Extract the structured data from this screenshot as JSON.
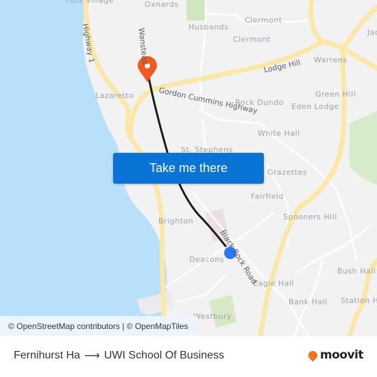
{
  "map": {
    "places": [
      {
        "name": "Fitts Village"
      },
      {
        "name": "Oxnards"
      },
      {
        "name": "Husbands"
      },
      {
        "name": "Clermont"
      },
      {
        "name": "Clermont"
      },
      {
        "name": "Jac"
      },
      {
        "name": "Warrens"
      },
      {
        "name": "Lazaretto"
      },
      {
        "name": "Green Hill"
      },
      {
        "name": "Rock Dundo"
      },
      {
        "name": "Eden Lodge"
      },
      {
        "name": "White Hall"
      },
      {
        "name": "St. Stephens"
      },
      {
        "name": "Grazettes"
      },
      {
        "name": "Fairfield"
      },
      {
        "name": "Spooners Hill"
      },
      {
        "name": "Brighton"
      },
      {
        "name": "Deacons"
      },
      {
        "name": "Eagle Hall"
      },
      {
        "name": "Bush Hall"
      },
      {
        "name": "Bank Hall"
      },
      {
        "name": "Station Hill"
      },
      {
        "name": "Westbury"
      }
    ],
    "roads": [
      {
        "name": "Highway 1"
      },
      {
        "name": "Wanstead"
      },
      {
        "name": "Gordon Cummins Highway"
      },
      {
        "name": "Lodge Hill"
      },
      {
        "name": "Black Rock Road"
      }
    ],
    "colors": {
      "water": "#b9e0fb",
      "land": "#f2f2f3",
      "major_road": "#fbe8a6",
      "route_line": "#1a1a1a",
      "destination_pin": "#f05a1e",
      "origin_dot": "#2979ff",
      "park": "#d7e8c4"
    },
    "destination_marker": {
      "icon": "map-pin-icon",
      "label": "UWI School Of Business"
    },
    "origin_marker": {
      "icon": "current-stop-dot-icon",
      "label": "Fernihurst Ha"
    }
  },
  "cta": {
    "label": "Take me there",
    "color": "#0a73d6"
  },
  "attribution": {
    "text": "© OpenStreetMap contributors | © OpenMapTiles"
  },
  "footer": {
    "origin": "Fernihurst Ha",
    "arrow": "⟶",
    "destination": "UWI School Of Business",
    "logo_text": "moovit",
    "logo_color": "#f4731f"
  }
}
